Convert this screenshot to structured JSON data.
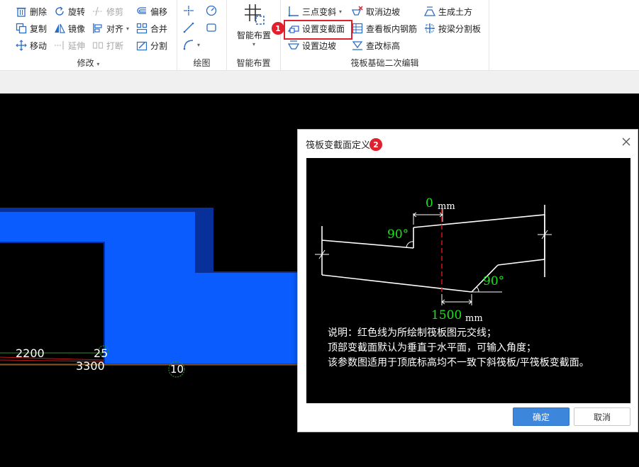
{
  "ribbon": {
    "modify": {
      "label": "修改",
      "delete": "删除",
      "copy": "复制",
      "move": "移动",
      "rotate": "旋转",
      "mirror": "镜像",
      "extend": "延伸",
      "trim": "修剪",
      "align": "对齐",
      "break": "打断",
      "offset": "偏移",
      "merge": "合并",
      "split": "分割"
    },
    "draw": {
      "label": "绘图"
    },
    "smart": {
      "label": "智能布置",
      "button": "智能布置"
    },
    "raft": {
      "label": "筏板基础二次编辑",
      "three_point_slope": "三点变斜",
      "set_variable_section": "设置变截面",
      "set_edge_slope": "设置边坡",
      "cancel_edge_slope": "取消边坡",
      "view_rebar": "查看板内钢筋",
      "check_elevation": "查改标高",
      "generate_earthwork": "生成土方",
      "split_by_beam": "按梁分割板"
    }
  },
  "canvas": {
    "dim1": "2200",
    "dim2": "3300",
    "dim3": "25",
    "axis_label": "10"
  },
  "dialog": {
    "title": "筏板变截面定义",
    "angle_top": "90°",
    "angle_bottom": "90°",
    "offset_value": "0",
    "offset_unit": "mm",
    "width_value": "1500",
    "width_unit": "mm",
    "notes": [
      "说明：红色线为所绘制筏板图元交线；",
      "顶部变截面默认为垂直于水平面，可输入角度；",
      "该参数图适用于顶底标高均不一致下斜筏板/平筏板变截面。"
    ],
    "ok": "确定",
    "cancel": "取消"
  },
  "callouts": {
    "step1": "1",
    "step2": "2"
  },
  "colors": {
    "accent": "#3c86dc",
    "highlight": "#e0202c",
    "fill_blue": "#0a5cff",
    "fill_dark": "#07309a",
    "dim_green": "#19e619"
  }
}
